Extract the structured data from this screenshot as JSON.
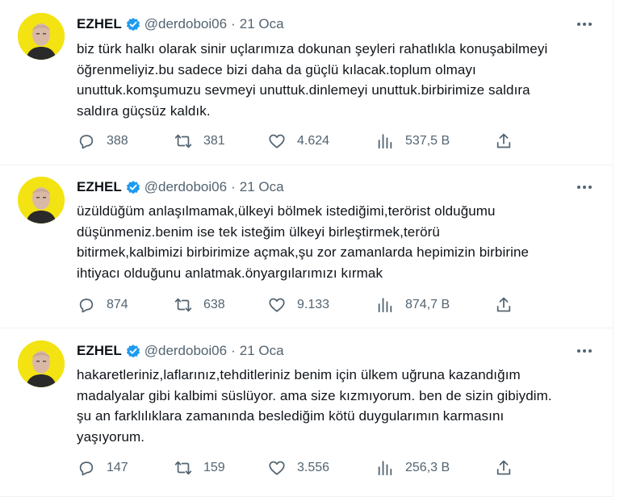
{
  "colors": {
    "text": "#0f1419",
    "muted": "#536471",
    "verified": "#1d9bf0",
    "divider": "#eff3f4",
    "avatar_bg": "#f3e312"
  },
  "icons": {
    "reply": "reply-icon",
    "retweet": "retweet-icon",
    "like": "heart-icon",
    "views": "views-icon",
    "share": "share-icon",
    "verified": "verified-badge-icon",
    "more": "more-icon"
  },
  "tweets": [
    {
      "name": "EZHEL",
      "handle": "@derdoboi06",
      "dot": "·",
      "date": "21 Oca",
      "lines": [
        "biz türk halkı olarak sinir uçlarımıza dokunan şeyleri rahatlıkla konuşabilmeyi",
        "öğrenmeliyiz.bu sadece bizi daha da güçlü kılacak.toplum olmayı",
        "unuttuk.komşumuzu sevmeyi unuttuk.dinlemeyi unuttuk.birbirimize saldıra",
        "saldıra güçsüz kaldık."
      ],
      "replies": "388",
      "retweets": "381",
      "likes": "4.624",
      "views": "537,5 B"
    },
    {
      "name": "EZHEL",
      "handle": "@derdoboi06",
      "dot": "·",
      "date": "21 Oca",
      "lines": [
        "üzüldüğüm anlaşılmamak,ülkeyi bölmek istediğimi,terörist olduğumu",
        "düşünmeniz.benim ise tek isteğim ülkeyi birleştirmek,terörü",
        "bitirmek,kalbimizi birbirimize açmak,şu zor zamanlarda hepimizin birbirine",
        "ihtiyacı olduğunu anlatmak.önyargılarımızı kırmak"
      ],
      "replies": "874",
      "retweets": "638",
      "likes": "9.133",
      "views": "874,7 B"
    },
    {
      "name": "EZHEL",
      "handle": "@derdoboi06",
      "dot": "·",
      "date": "21 Oca",
      "lines": [
        "hakaretleriniz,laflarınız,tehditleriniz benim için ülkem uğruna kazandığım",
        "madalyalar gibi kalbimi süslüyor. ama size kızmıyorum. ben de sizin gibiydim.",
        "şu an farklılıklara zamanında beslediğim kötü duygularımın karmasını",
        "yaşıyorum."
      ],
      "replies": "147",
      "retweets": "159",
      "likes": "3.556",
      "views": "256,3 B"
    }
  ]
}
